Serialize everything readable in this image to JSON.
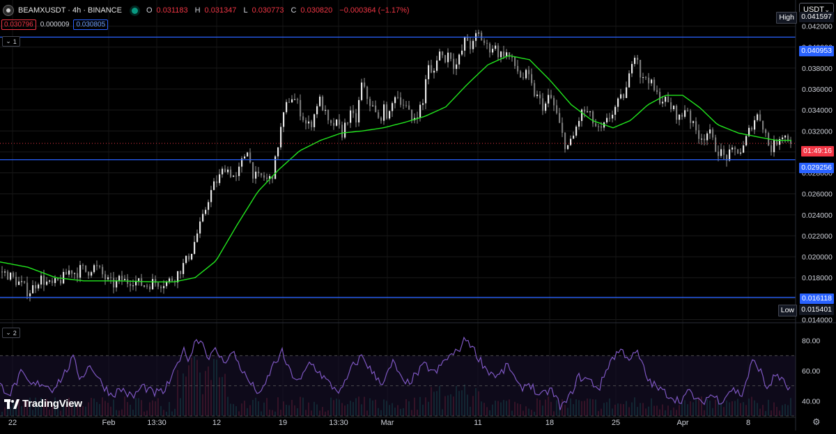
{
  "header": {
    "symbol": "BEAMXUSDT · 4h · BINANCE",
    "o_label": "O",
    "o": "0.031183",
    "h_label": "H",
    "h": "0.031347",
    "l_label": "L",
    "l": "0.030773",
    "c_label": "C",
    "c": "0.030820",
    "change": "−0.000364 (−1.17%)",
    "bid": "0.030796",
    "spread": "0.000009",
    "ask": "0.030805"
  },
  "currency": "USDT",
  "panes": {
    "main_id": "1",
    "indicator_id": "2"
  },
  "colors": {
    "background": "#000000",
    "up_candle": "#089981",
    "down_candle": "#f23645",
    "moving_average": "#22e81e",
    "horizontal_lines": "#2962ff",
    "rsi_line": "#7e57c2"
  },
  "price_axis_ticks": [
    "0.042000",
    "0.040000",
    "0.038000",
    "0.036000",
    "0.034000",
    "0.032000",
    "0.030000",
    "0.028000",
    "0.026000",
    "0.024000",
    "0.022000",
    "0.020000",
    "0.018000",
    "0.016000",
    "0.014000"
  ],
  "price_labels": {
    "high_tag": "High",
    "high_value": "0.041597",
    "line_upper": "0.040953",
    "countdown": "01:49:16",
    "line_mid": "0.029256",
    "line_lower": "0.016118",
    "low_tag": "Low",
    "low_value": "0.015401"
  },
  "rsi_axis_ticks": [
    "80.00",
    "60.00",
    "40.00"
  ],
  "time_axis_ticks": [
    "22",
    "Feb",
    "13:30",
    "12",
    "19",
    "13:30",
    "Mar",
    "11",
    "18",
    "25",
    "Apr",
    "8"
  ],
  "branding": "TradingView",
  "chart_data": {
    "type": "candlestick",
    "title": "BEAMXUSDT · 4h · BINANCE",
    "ylim": [
      0.014,
      0.0435
    ],
    "horizontal_levels": [
      0.040953,
      0.029256,
      0.016118
    ],
    "last_price": 0.03082,
    "high": 0.041597,
    "low": 0.015401,
    "price_path": [
      [
        0,
        0.0186
      ],
      [
        10,
        0.0183
      ],
      [
        20,
        0.0178
      ],
      [
        30,
        0.0173
      ],
      [
        40,
        0.0166
      ],
      [
        48,
        0.0172
      ],
      [
        56,
        0.018
      ],
      [
        64,
        0.0176
      ],
      [
        72,
        0.0172
      ],
      [
        80,
        0.0175
      ],
      [
        90,
        0.018
      ],
      [
        100,
        0.0188
      ],
      [
        108,
        0.0184
      ],
      [
        116,
        0.0189
      ],
      [
        124,
        0.0185
      ],
      [
        132,
        0.0191
      ],
      [
        140,
        0.0188
      ],
      [
        148,
        0.0181
      ],
      [
        156,
        0.0175
      ],
      [
        164,
        0.0173
      ],
      [
        172,
        0.0179
      ],
      [
        180,
        0.0176
      ],
      [
        190,
        0.0178
      ],
      [
        200,
        0.0174
      ],
      [
        210,
        0.0173
      ],
      [
        220,
        0.0176
      ],
      [
        230,
        0.0175
      ],
      [
        240,
        0.0176
      ],
      [
        250,
        0.0181
      ],
      [
        258,
        0.0188
      ],
      [
        266,
        0.0196
      ],
      [
        274,
        0.0206
      ],
      [
        282,
        0.0222
      ],
      [
        290,
        0.0236
      ],
      [
        298,
        0.0256
      ],
      [
        306,
        0.0268
      ],
      [
        314,
        0.0276
      ],
      [
        322,
        0.0286
      ],
      [
        330,
        0.028
      ],
      [
        338,
        0.0274
      ],
      [
        346,
        0.029
      ],
      [
        354,
        0.0304
      ],
      [
        360,
        0.0282
      ],
      [
        368,
        0.0274
      ],
      [
        376,
        0.0277
      ],
      [
        384,
        0.0272
      ],
      [
        392,
        0.0282
      ],
      [
        400,
        0.0316
      ],
      [
        408,
        0.034
      ],
      [
        416,
        0.0354
      ],
      [
        424,
        0.0348
      ],
      [
        432,
        0.0336
      ],
      [
        440,
        0.0324
      ],
      [
        448,
        0.033
      ],
      [
        456,
        0.0352
      ],
      [
        464,
        0.034
      ],
      [
        472,
        0.0322
      ],
      [
        480,
        0.0328
      ],
      [
        490,
        0.0318
      ],
      [
        500,
        0.0336
      ],
      [
        510,
        0.033
      ],
      [
        518,
        0.0364
      ],
      [
        526,
        0.0352
      ],
      [
        534,
        0.0342
      ],
      [
        542,
        0.033
      ],
      [
        550,
        0.034
      ],
      [
        558,
        0.0334
      ],
      [
        566,
        0.0356
      ],
      [
        574,
        0.035
      ],
      [
        582,
        0.0342
      ],
      [
        590,
        0.033
      ],
      [
        598,
        0.0338
      ],
      [
        606,
        0.0346
      ],
      [
        612,
        0.0384
      ],
      [
        620,
        0.037
      ],
      [
        628,
        0.0398
      ],
      [
        636,
        0.0388
      ],
      [
        644,
        0.0396
      ],
      [
        652,
        0.038
      ],
      [
        660,
        0.0392
      ],
      [
        668,
        0.041
      ],
      [
        676,
        0.0398
      ],
      [
        684,
        0.0414
      ],
      [
        692,
        0.0406
      ],
      [
        700,
        0.0398
      ],
      [
        708,
        0.0402
      ],
      [
        716,
        0.0392
      ],
      [
        724,
        0.0396
      ],
      [
        732,
        0.0388
      ],
      [
        740,
        0.038
      ],
      [
        748,
        0.037
      ],
      [
        756,
        0.0374
      ],
      [
        764,
        0.0358
      ],
      [
        772,
        0.035
      ],
      [
        780,
        0.0342
      ],
      [
        788,
        0.0354
      ],
      [
        796,
        0.034
      ],
      [
        804,
        0.032
      ],
      [
        812,
        0.0304
      ],
      [
        820,
        0.031
      ],
      [
        828,
        0.0328
      ],
      [
        836,
        0.034
      ],
      [
        844,
        0.0336
      ],
      [
        852,
        0.0326
      ],
      [
        860,
        0.0318
      ],
      [
        868,
        0.0326
      ],
      [
        876,
        0.0336
      ],
      [
        884,
        0.0344
      ],
      [
        892,
        0.0352
      ],
      [
        900,
        0.0362
      ],
      [
        908,
        0.0398
      ],
      [
        914,
        0.039
      ],
      [
        920,
        0.0366
      ],
      [
        928,
        0.0374
      ],
      [
        936,
        0.036
      ],
      [
        944,
        0.0352
      ],
      [
        952,
        0.035
      ],
      [
        960,
        0.0344
      ],
      [
        968,
        0.0338
      ],
      [
        976,
        0.033
      ],
      [
        984,
        0.0346
      ],
      [
        992,
        0.0326
      ],
      [
        1000,
        0.0318
      ],
      [
        1008,
        0.0314
      ],
      [
        1016,
        0.032
      ],
      [
        1024,
        0.0306
      ],
      [
        1032,
        0.03
      ],
      [
        1040,
        0.0294
      ],
      [
        1048,
        0.0298
      ],
      [
        1056,
        0.0302
      ],
      [
        1064,
        0.03
      ],
      [
        1072,
        0.0316
      ],
      [
        1080,
        0.033
      ],
      [
        1088,
        0.0336
      ],
      [
        1096,
        0.0322
      ],
      [
        1104,
        0.0302
      ],
      [
        1112,
        0.0308
      ],
      [
        1120,
        0.0318
      ],
      [
        1128,
        0.0314
      ],
      [
        1136,
        0.031
      ]
    ],
    "moving_average_path": [
      [
        0,
        0.0195
      ],
      [
        40,
        0.019
      ],
      [
        80,
        0.018
      ],
      [
        120,
        0.0177
      ],
      [
        170,
        0.0177
      ],
      [
        220,
        0.0176
      ],
      [
        250,
        0.0176
      ],
      [
        280,
        0.018
      ],
      [
        310,
        0.0196
      ],
      [
        340,
        0.023
      ],
      [
        370,
        0.0262
      ],
      [
        400,
        0.0283
      ],
      [
        430,
        0.0301
      ],
      [
        460,
        0.0311
      ],
      [
        490,
        0.0318
      ],
      [
        520,
        0.032
      ],
      [
        550,
        0.0323
      ],
      [
        580,
        0.0328
      ],
      [
        610,
        0.0334
      ],
      [
        640,
        0.0343
      ],
      [
        670,
        0.0364
      ],
      [
        700,
        0.0383
      ],
      [
        730,
        0.0392
      ],
      [
        760,
        0.0388
      ],
      [
        790,
        0.0368
      ],
      [
        820,
        0.0345
      ],
      [
        850,
        0.033
      ],
      [
        880,
        0.0323
      ],
      [
        905,
        0.033
      ],
      [
        930,
        0.0345
      ],
      [
        955,
        0.0354
      ],
      [
        980,
        0.0354
      ],
      [
        1005,
        0.0342
      ],
      [
        1030,
        0.0326
      ],
      [
        1060,
        0.0318
      ],
      [
        1090,
        0.0314
      ],
      [
        1115,
        0.0311
      ],
      [
        1136,
        0.0311
      ]
    ],
    "rsi": {
      "ylim": [
        30,
        90
      ],
      "bands": [
        70,
        50,
        30
      ],
      "series": [
        [
          0,
          50
        ],
        [
          15,
          45
        ],
        [
          30,
          58
        ],
        [
          45,
          50
        ],
        [
          60,
          52
        ],
        [
          75,
          48
        ],
        [
          90,
          56
        ],
        [
          105,
          68
        ],
        [
          115,
          55
        ],
        [
          130,
          64
        ],
        [
          145,
          52
        ],
        [
          160,
          44
        ],
        [
          175,
          48
        ],
        [
          190,
          42
        ],
        [
          205,
          50
        ],
        [
          220,
          45
        ],
        [
          235,
          46
        ],
        [
          250,
          58
        ],
        [
          262,
          74
        ],
        [
          272,
          68
        ],
        [
          282,
          82
        ],
        [
          292,
          78
        ],
        [
          300,
          68
        ],
        [
          310,
          74
        ],
        [
          320,
          66
        ],
        [
          335,
          72
        ],
        [
          350,
          58
        ],
        [
          362,
          50
        ],
        [
          375,
          44
        ],
        [
          390,
          62
        ],
        [
          405,
          72
        ],
        [
          415,
          60
        ],
        [
          430,
          52
        ],
        [
          445,
          66
        ],
        [
          460,
          58
        ],
        [
          475,
          50
        ],
        [
          490,
          46
        ],
        [
          505,
          62
        ],
        [
          520,
          70
        ],
        [
          535,
          58
        ],
        [
          550,
          52
        ],
        [
          565,
          66
        ],
        [
          580,
          50
        ],
        [
          595,
          56
        ],
        [
          610,
          64
        ],
        [
          625,
          58
        ],
        [
          640,
          68
        ],
        [
          655,
          72
        ],
        [
          670,
          82
        ],
        [
          685,
          70
        ],
        [
          700,
          60
        ],
        [
          715,
          56
        ],
        [
          730,
          64
        ],
        [
          745,
          48
        ],
        [
          760,
          52
        ],
        [
          775,
          42
        ],
        [
          790,
          48
        ],
        [
          805,
          36
        ],
        [
          815,
          40
        ],
        [
          830,
          56
        ],
        [
          845,
          54
        ],
        [
          860,
          48
        ],
        [
          875,
          66
        ],
        [
          890,
          74
        ],
        [
          905,
          68
        ],
        [
          915,
          72
        ],
        [
          930,
          54
        ],
        [
          945,
          48
        ],
        [
          960,
          44
        ],
        [
          975,
          40
        ],
        [
          990,
          46
        ],
        [
          1005,
          38
        ],
        [
          1020,
          44
        ],
        [
          1035,
          40
        ],
        [
          1050,
          48
        ],
        [
          1065,
          44
        ],
        [
          1080,
          66
        ],
        [
          1090,
          62
        ],
        [
          1100,
          48
        ],
        [
          1115,
          58
        ],
        [
          1125,
          52
        ],
        [
          1136,
          46
        ]
      ]
    },
    "volume_present": true
  }
}
